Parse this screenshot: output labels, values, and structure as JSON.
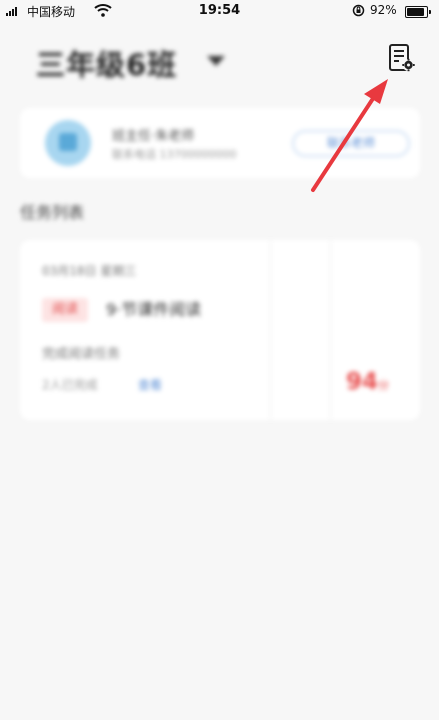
{
  "status_bar": {
    "carrier": "中国移动",
    "time": "19:54",
    "battery_percent": "92%"
  },
  "header": {
    "class_title": "三年级6班",
    "settings_icon": "document-settings-icon"
  },
  "teacher_card": {
    "name": "班主任·朱老师",
    "phone": "联系电话 13700000000",
    "action_label": "联系老师"
  },
  "section_title": "任务列表",
  "task_card": {
    "date": "03月18日 星期三",
    "tag": "阅读",
    "title": "9·节课件阅读",
    "description": "完成阅读任务",
    "publish_info": "2人已完成",
    "link_label": "查看",
    "score": "94",
    "score_unit": "分"
  },
  "annotation": {
    "arrow_color": "#e8393f"
  }
}
